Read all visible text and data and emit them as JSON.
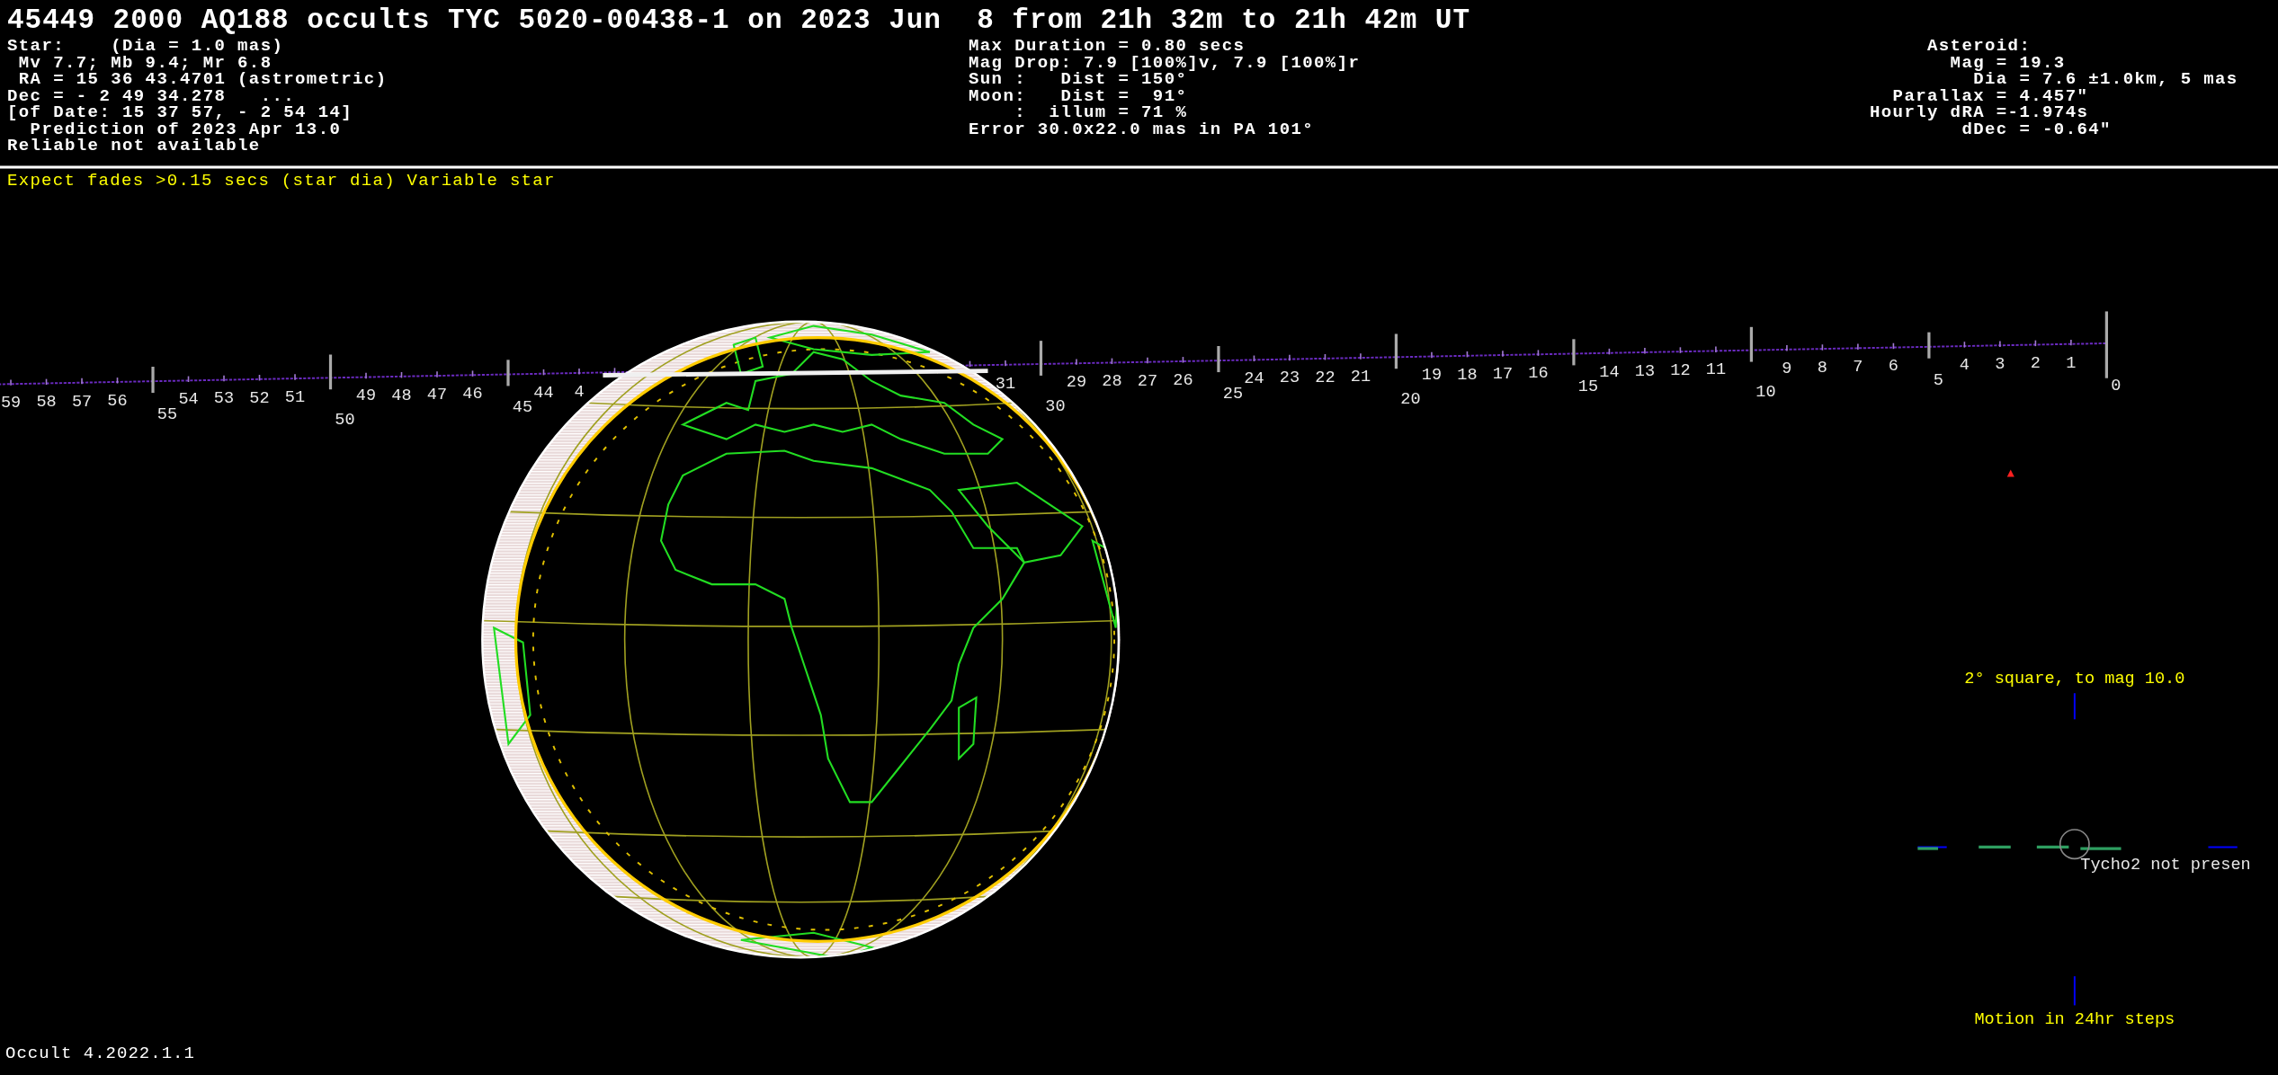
{
  "title": "45449 2000 AQ188 occults TYC 5020-00438-1 on 2023 Jun  8 from 21h 32m to 21h 42m UT",
  "star": {
    "lines": [
      "Star:    (Dia = 1.0 mas)",
      " Mv 7.7; Mb 9.4; Mr 6.8",
      " RA = 15 36 43.4701 (astrometric)",
      "Dec = - 2 49 34.278   ...",
      "[of Date: 15 37 57, - 2 54 14]",
      "  Prediction of 2023 Apr 13.0",
      "Reliable not available"
    ]
  },
  "event": {
    "lines": [
      "Max Duration = 0.80 secs",
      "Mag Drop: 7.9 [100%]v, 7.9 [100%]r",
      "Sun :   Dist = 150°",
      "Moon:   Dist =  91°",
      "    :  illum = 71 %",
      "Error 30.0x22.0 mas in PA 101°"
    ]
  },
  "asteroid": {
    "lines": [
      "     Asteroid:",
      "       Mag = 19.3",
      "         Dia = 7.6 ±1.0km, 5 mas",
      "  Parallax = 4.457\"",
      "Hourly dRA =-1.974s",
      "        dDec = -0.64\""
    ]
  },
  "note": "Expect fades >0.15 secs (star dia) Variable star",
  "time_scale": {
    "labels": [
      "59",
      "58",
      "57",
      "56",
      "55",
      "54",
      "53",
      "52",
      "51",
      "50",
      "49",
      "48",
      "47",
      "46",
      "45",
      "44",
      "4",
      "31",
      "30",
      "29",
      "28",
      "27",
      "26",
      "25",
      "24",
      "23",
      "22",
      "21",
      "20",
      "19",
      "18",
      "17",
      "16",
      "15",
      "14",
      "13",
      "12",
      "11",
      "10",
      "9",
      "8",
      "7",
      "6",
      "5",
      "4",
      "3",
      "2",
      "1",
      "0"
    ]
  },
  "star_chart": {
    "caption": "2° square, to mag 10.0",
    "message": "Tycho2 not presen",
    "motion_caption": "Motion in 24hr steps"
  },
  "version": "Occult 4.2022.1.1"
}
